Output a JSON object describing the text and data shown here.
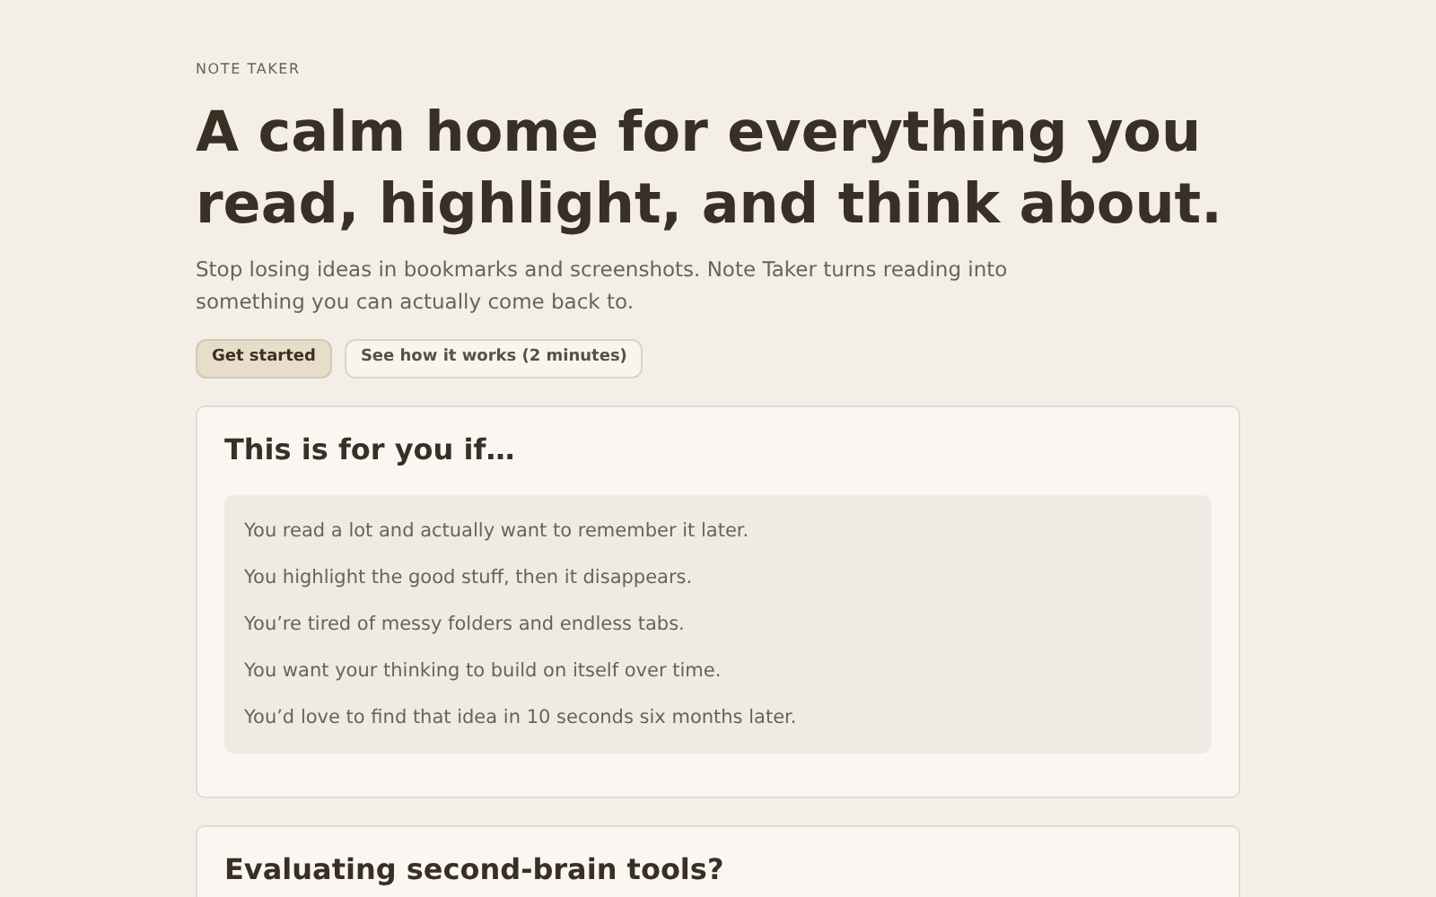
{
  "eyebrow": "NOTE TAKER",
  "headline": "A calm home for everything you read, highlight, and think about.",
  "intro": "Stop losing ideas in bookmarks and screenshots. Note Taker turns reading into something you can actually come back to.",
  "buttons": [
    {
      "label": "Get started",
      "kind": "primary"
    },
    {
      "label": "See how it works (2 minutes)",
      "kind": "secondary"
    }
  ],
  "sections": [
    {
      "title": "This is for you if…",
      "items": [
        "You read a lot and actually want to remember it later.",
        "You highlight the good stuff, then it disappears.",
        "You’re tired of messy folders and endless tabs.",
        "You want your thinking to build on itself over time.",
        "You’d love to find that idea in 10 seconds six months later."
      ]
    },
    {
      "title": "Evaluating second-brain tools?"
    }
  ]
}
